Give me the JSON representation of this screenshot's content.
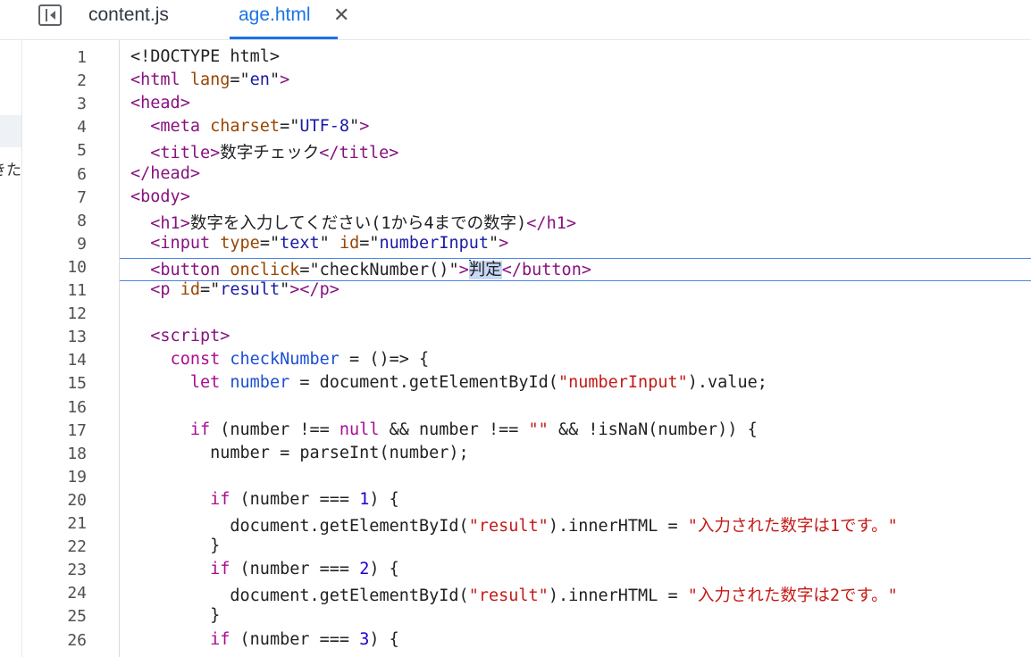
{
  "tabs": {
    "sidebar_toggle_icon": "sidebar-panel-icon",
    "tab1": "content.js",
    "tab2": "age.html",
    "close_glyph": "✕"
  },
  "left_fragment": "きた",
  "colors": {
    "tag": "#881280",
    "attribute": "#994500",
    "attr_string": "#1a1aa6",
    "js_keyword": "#aa0d91",
    "js_string": "#c41a16",
    "active_tab": "#1a73e8"
  },
  "editor": {
    "active_line": 10,
    "lines": [
      [
        [
          "<!DOCTYPE html>",
          "plain"
        ]
      ],
      [
        [
          "<html ",
          "tag"
        ],
        [
          "lang",
          "attr"
        ],
        [
          "=\"",
          "plain"
        ],
        [
          "en",
          "str"
        ],
        [
          "\"",
          "plain"
        ],
        [
          ">",
          "tag"
        ]
      ],
      [
        [
          "<head>",
          "tag"
        ]
      ],
      [
        [
          "  ",
          "plain"
        ],
        [
          "<meta ",
          "tag"
        ],
        [
          "charset",
          "attr"
        ],
        [
          "=\"",
          "plain"
        ],
        [
          "UTF-8",
          "str"
        ],
        [
          "\"",
          "plain"
        ],
        [
          ">",
          "tag"
        ]
      ],
      [
        [
          "  ",
          "plain"
        ],
        [
          "<title>",
          "tag"
        ],
        [
          "数字チェック",
          "plain"
        ],
        [
          "</title>",
          "tag"
        ]
      ],
      [
        [
          "</head>",
          "tag"
        ]
      ],
      [
        [
          "<body>",
          "tag"
        ]
      ],
      [
        [
          "  ",
          "plain"
        ],
        [
          "<h1>",
          "tag"
        ],
        [
          "数字を入力してください(1から4までの数字)",
          "plain"
        ],
        [
          "</h1>",
          "tag"
        ]
      ],
      [
        [
          "  ",
          "plain"
        ],
        [
          "<input ",
          "tag"
        ],
        [
          "type",
          "attr"
        ],
        [
          "=\"",
          "plain"
        ],
        [
          "text",
          "str"
        ],
        [
          "\" ",
          "plain"
        ],
        [
          "id",
          "attr"
        ],
        [
          "=\"",
          "plain"
        ],
        [
          "numberInput",
          "str"
        ],
        [
          "\"",
          "plain"
        ],
        [
          ">",
          "tag"
        ]
      ],
      [
        [
          "  ",
          "plain"
        ],
        [
          "<button ",
          "tag"
        ],
        [
          "onclick",
          "attr"
        ],
        [
          "=\"",
          "plain"
        ],
        [
          "checkNumber()",
          "plain"
        ],
        [
          "\"",
          "plain"
        ],
        [
          ">",
          "tag"
        ],
        [
          "判定",
          "sel"
        ],
        [
          "</button>",
          "tag"
        ]
      ],
      [
        [
          "  ",
          "plain"
        ],
        [
          "<p ",
          "tag"
        ],
        [
          "id",
          "attr"
        ],
        [
          "=\"",
          "plain"
        ],
        [
          "result",
          "str"
        ],
        [
          "\"",
          "plain"
        ],
        [
          "></p>",
          "tag"
        ]
      ],
      [
        [
          "",
          "plain"
        ]
      ],
      [
        [
          "  ",
          "plain"
        ],
        [
          "<script>",
          "tag"
        ]
      ],
      [
        [
          "    ",
          "plain"
        ],
        [
          "const ",
          "kw"
        ],
        [
          "checkNumber",
          "var"
        ],
        [
          " = ()=> {",
          "plain"
        ]
      ],
      [
        [
          "      ",
          "plain"
        ],
        [
          "let ",
          "kw"
        ],
        [
          "number",
          "var"
        ],
        [
          " = document.getElementById(",
          "plain"
        ],
        [
          "\"numberInput\"",
          "jsstr"
        ],
        [
          ").value;",
          "plain"
        ]
      ],
      [
        [
          "",
          "plain"
        ]
      ],
      [
        [
          "      ",
          "plain"
        ],
        [
          "if ",
          "kw"
        ],
        [
          "(number !== ",
          "plain"
        ],
        [
          "null",
          "kw"
        ],
        [
          " && number !== ",
          "plain"
        ],
        [
          "\"\"",
          "jsstr"
        ],
        [
          " && !isNaN(number)) {",
          "plain"
        ]
      ],
      [
        [
          "        number = parseInt(number);",
          "plain"
        ]
      ],
      [
        [
          "",
          "plain"
        ]
      ],
      [
        [
          "        ",
          "plain"
        ],
        [
          "if ",
          "kw"
        ],
        [
          "(number === ",
          "plain"
        ],
        [
          "1",
          "kw2"
        ],
        [
          ") {",
          "plain"
        ]
      ],
      [
        [
          "          document.getElementById(",
          "plain"
        ],
        [
          "\"result\"",
          "jsstr"
        ],
        [
          ").innerHTML = ",
          "plain"
        ],
        [
          "\"入力された数字は1です。\"",
          "jsstr"
        ]
      ],
      [
        [
          "        }",
          "plain"
        ]
      ],
      [
        [
          "        ",
          "plain"
        ],
        [
          "if ",
          "kw"
        ],
        [
          "(number === ",
          "plain"
        ],
        [
          "2",
          "kw2"
        ],
        [
          ") {",
          "plain"
        ]
      ],
      [
        [
          "          document.getElementById(",
          "plain"
        ],
        [
          "\"result\"",
          "jsstr"
        ],
        [
          ").innerHTML = ",
          "plain"
        ],
        [
          "\"入力された数字は2です。\"",
          "jsstr"
        ]
      ],
      [
        [
          "        }",
          "plain"
        ]
      ],
      [
        [
          "        ",
          "plain"
        ],
        [
          "if ",
          "kw"
        ],
        [
          "(number === ",
          "plain"
        ],
        [
          "3",
          "kw2"
        ],
        [
          ") {",
          "plain"
        ]
      ]
    ]
  }
}
